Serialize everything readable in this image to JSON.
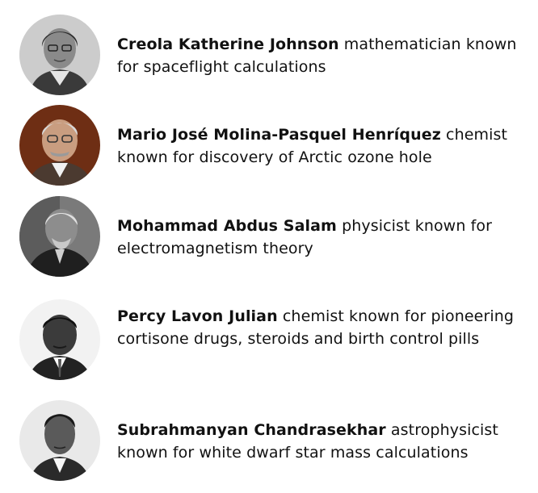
{
  "people": [
    {
      "name": "Creola Katherine Johnson",
      "description": "mathematician known for spaceflight calculations",
      "photo_icon": "portrait-photo"
    },
    {
      "name": "Mario José Molina-Pasquel Henríquez",
      "description": "chemist known for discovery of Arctic ozone hole",
      "photo_icon": "portrait-photo"
    },
    {
      "name": "Mohammad Abdus Salam",
      "description": "physicist known for electromagnetism theory",
      "photo_icon": "portrait-photo"
    },
    {
      "name": "Percy Lavon Julian",
      "description": "chemist known for pioneering cortisone drugs, steroids and birth control pills",
      "photo_icon": "portrait-photo"
    },
    {
      "name": "Subrahmanyan Chandrasekhar",
      "description": "astrophysicist known for white dwarf star mass calculations",
      "photo_icon": "portrait-photo"
    }
  ]
}
